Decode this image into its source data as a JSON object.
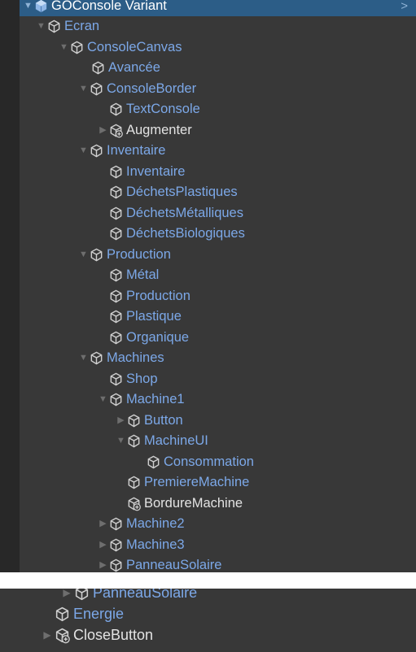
{
  "hierarchy": {
    "root_label": "GOConsole Variant",
    "nodes": [
      {
        "label": "Ecran",
        "arrow": "▼",
        "white": false
      },
      {
        "label": "ConsoleCanvas",
        "arrow": "▼",
        "white": false
      },
      {
        "label": "Avancée",
        "arrow": "",
        "white": false
      },
      {
        "label": "ConsoleBorder",
        "arrow": "▼",
        "white": false
      },
      {
        "label": "TextConsole",
        "arrow": "",
        "white": false
      },
      {
        "label": "Augmenter",
        "arrow": "▶",
        "white": true
      },
      {
        "label": "Inventaire",
        "arrow": "▼",
        "white": false
      },
      {
        "label": "Inventaire",
        "arrow": "",
        "white": false
      },
      {
        "label": "DéchetsPlastiques",
        "arrow": "",
        "white": false
      },
      {
        "label": "DéchetsMétalliques",
        "arrow": "",
        "white": false
      },
      {
        "label": "DéchetsBiologiques",
        "arrow": "",
        "white": false
      },
      {
        "label": "Production",
        "arrow": "▼",
        "white": false
      },
      {
        "label": "Métal",
        "arrow": "",
        "white": false
      },
      {
        "label": "Production",
        "arrow": "",
        "white": false
      },
      {
        "label": "Plastique",
        "arrow": "",
        "white": false
      },
      {
        "label": "Organique",
        "arrow": "",
        "white": false
      },
      {
        "label": "Machines",
        "arrow": "▼",
        "white": false
      },
      {
        "label": "Shop",
        "arrow": "",
        "white": false
      },
      {
        "label": "Machine1",
        "arrow": "▼",
        "white": false
      },
      {
        "label": "Button",
        "arrow": "▶",
        "white": false
      },
      {
        "label": "MachineUI",
        "arrow": "▼",
        "white": false
      },
      {
        "label": "Consommation",
        "arrow": "",
        "white": false
      },
      {
        "label": "PremiereMachine",
        "arrow": "",
        "white": false
      },
      {
        "label": "BordureMachine",
        "arrow": "",
        "white": true
      },
      {
        "label": "Machine2",
        "arrow": "▶",
        "white": false
      },
      {
        "label": "Machine3",
        "arrow": "▶",
        "white": false
      },
      {
        "label": "PanneauSolaire",
        "arrow": "▶",
        "white": false
      }
    ]
  },
  "bottom": {
    "items": [
      {
        "label": "PanneauSolaire",
        "arrow": "▶",
        "white": false
      },
      {
        "label": "Energie",
        "arrow": "",
        "white": false
      },
      {
        "label": "CloseButton",
        "arrow": "▶",
        "white": true
      }
    ]
  },
  "icons": {
    "root": "prefab-cube-icon",
    "node": "gameobject-cube-icon",
    "node_alt": "gameobject-cube-add-icon"
  },
  "colors": {
    "selected_bg": "#2c5d87",
    "prefab_text": "#7ca8e8",
    "plain_text": "#e3e3e3"
  }
}
